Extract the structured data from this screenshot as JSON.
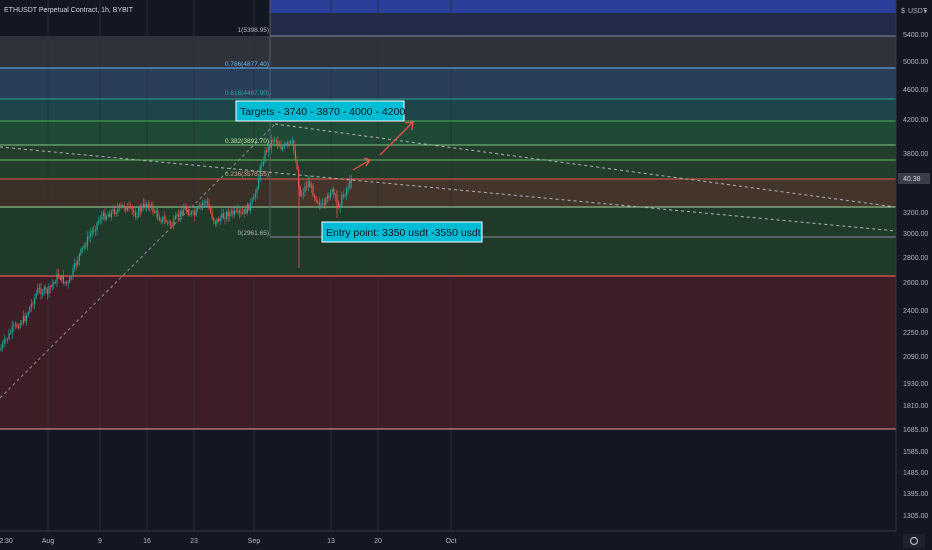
{
  "header": {
    "title": "ETHUSDT Perpetual Contract, 1h, BYBIT",
    "currency_button": "USDT",
    "currency_prefix": "$"
  },
  "colors": {
    "background": "#131722",
    "candle_up": "#26a69a",
    "candle_down": "#ef5350",
    "axis_text": "#b2b5be",
    "label_box_fill": "#00bcd4",
    "label_box_border": "#ffffff",
    "price_tag": "#3a3e4a"
  },
  "price_axis": {
    "ticks": [
      "5400.00",
      "5000.00",
      "4600.00",
      "4200.00",
      "3800.00",
      "3200.00",
      "3000.00",
      "2800.00",
      "2600.00",
      "2400.00",
      "2250.00",
      "2090.00",
      "1930.00",
      "1810.00",
      "1685.00",
      "1585.00",
      "1485.00",
      "1395.00",
      "1305.00"
    ],
    "current_price_label": "40.38"
  },
  "time_axis": {
    "ticks": [
      "2:30",
      "Aug",
      "9",
      "16",
      "23",
      "Sep",
      "13",
      "20",
      "Oct"
    ]
  },
  "fib_labels": {
    "level_1": "1(5398.95)",
    "level_0786": "0.786(4877.40)",
    "level_0618": "0.618(4467.90)",
    "level_0382": "0.382(3892.70)",
    "level_0236": "0.236(3578.55)",
    "level_0": "0(2961.65)"
  },
  "annotations": {
    "targets": "Targets -   3740 - 3870 - 4000 - 4200",
    "entry": "Entry point: 3350 usdt -3550 usdt"
  },
  "chart_data": {
    "type": "candlestick",
    "title": "ETHUSDT Perpetual Contract, 1h, BYBIT",
    "y_scale": "log",
    "fib_retracement": [
      {
        "level": 1,
        "price": 5398.95
      },
      {
        "level": 0.786,
        "price": 4877.4
      },
      {
        "level": 0.618,
        "price": 4467.9
      },
      {
        "level": 0.382,
        "price": 3892.7
      },
      {
        "level": 0.236,
        "price": 3578.55
      },
      {
        "level": 0,
        "price": 2961.65
      }
    ],
    "targets": [
      3740,
      3870,
      4000,
      4200
    ],
    "entry_range": [
      3350,
      3550
    ],
    "price_trend": [
      {
        "date": "late Jul",
        "price": 2150
      },
      {
        "date": "Aug 1",
        "price": 2450
      },
      {
        "date": "Aug 9",
        "price": 3150
      },
      {
        "date": "Aug 16",
        "price": 3250
      },
      {
        "date": "Aug 23",
        "price": 3150
      },
      {
        "date": "Sep 1",
        "price": 3450
      },
      {
        "date": "Sep 3",
        "price": 3950
      },
      {
        "date": "Sep 7",
        "price": 3300
      },
      {
        "date": "Sep 13",
        "price": 3300
      },
      {
        "date": "Sep 15",
        "price": 3550
      }
    ]
  }
}
